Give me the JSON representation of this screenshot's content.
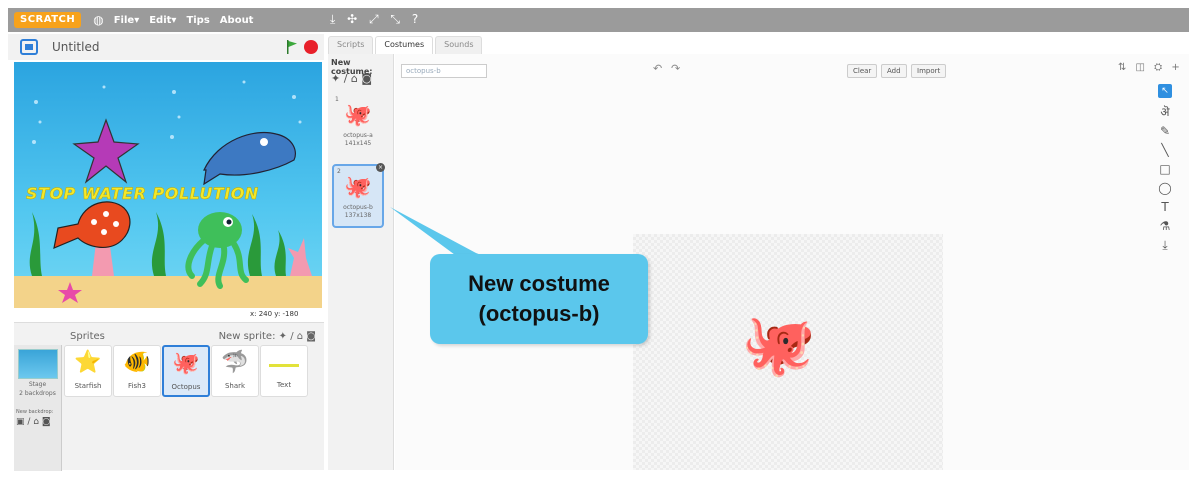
{
  "menubar": {
    "logo": "SCRATCH",
    "items": [
      "File▾",
      "Edit▾",
      "Tips",
      "About"
    ],
    "tool_icons": "⤓ ✣ ⤢ ⤡ ?"
  },
  "stage": {
    "title": "Untitled",
    "banner_text": "STOP WATER POLLUTION",
    "coords": "x: 240  y: -180"
  },
  "sprites": {
    "header": "Sprites",
    "new_sprite_label": "New sprite:",
    "new_sprite_icons": "✦ / ⌂ ◙",
    "stage_label": "Stage",
    "stage_sub": "2 backdrops",
    "new_backdrop": "New backdrop:",
    "backdrop_icons": "▣ / ⌂ ◙",
    "items": [
      {
        "name": "Starfish",
        "emoji": "⭐"
      },
      {
        "name": "Fish3",
        "emoji": "🐠"
      },
      {
        "name": "Octopus",
        "emoji": "🐙"
      },
      {
        "name": "Shark",
        "emoji": "🦈"
      },
      {
        "name": "Text",
        "emoji": ""
      }
    ]
  },
  "tabs": [
    "Scripts",
    "Costumes",
    "Sounds"
  ],
  "costumes": {
    "new_label": "New costume:",
    "icons": "✦ / ⌂ ◙",
    "items": [
      {
        "num": "1",
        "name": "octopus-a",
        "size": "141x145",
        "emoji": "🐙"
      },
      {
        "num": "2",
        "name": "octopus-b",
        "size": "137x138",
        "emoji": "🐙"
      }
    ]
  },
  "editor": {
    "costume_name": "octopus-b",
    "undo": "↶",
    "redo": "↷",
    "clear": "Clear",
    "add": "Add",
    "import": "Import",
    "top_icons": "⇅ ◫ ⛭ +",
    "canvas_sprite": "🐙"
  },
  "tools": [
    "↖",
    "ऄ",
    "✎",
    "╲",
    "□",
    "◯",
    "T",
    "⚗",
    "⤓"
  ],
  "callout": {
    "line1": "New costume",
    "line2": "(octopus-b)"
  },
  "colors": {
    "accent": "#2f7fd8",
    "callout": "#5bc7ec",
    "menubar": "#9b9b9b"
  }
}
